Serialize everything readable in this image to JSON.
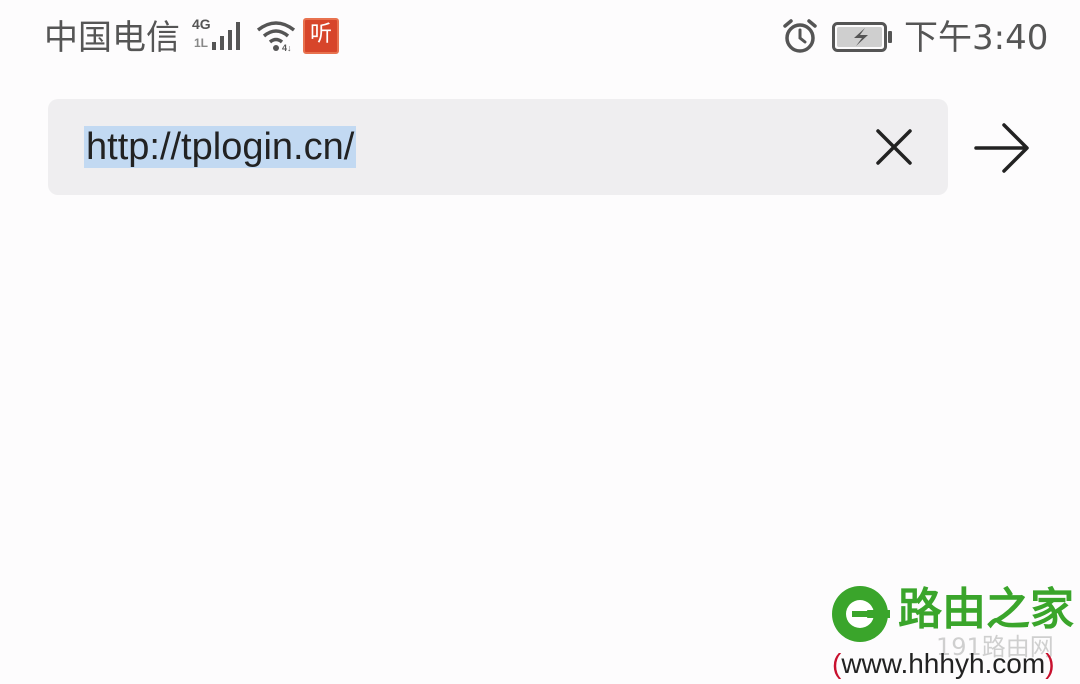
{
  "status_bar": {
    "carrier": "中国电信",
    "network_type": "4G",
    "network_sub": "1L",
    "signal_icon": "signal-bars-icon",
    "wifi_icon": "wifi-icon",
    "app_badge": "听",
    "alarm_icon": "alarm-clock-icon",
    "battery_icon": "battery-charging-icon",
    "time": "下午3:40"
  },
  "url_bar": {
    "value": "http://tplogin.cn/",
    "clear_icon": "close-icon",
    "go_icon": "arrow-right-icon"
  },
  "watermark": {
    "name": "路由之家",
    "sub": "191路由网",
    "url_open": "(",
    "url": "www.hhhyh.com",
    "url_close": ")"
  },
  "colors": {
    "background": "#fdfcfd",
    "url_bar_bg": "#efeef0",
    "selection": "#c2d9f2",
    "watermark_green": "#3aa52b",
    "watermark_red": "#c8102e"
  }
}
